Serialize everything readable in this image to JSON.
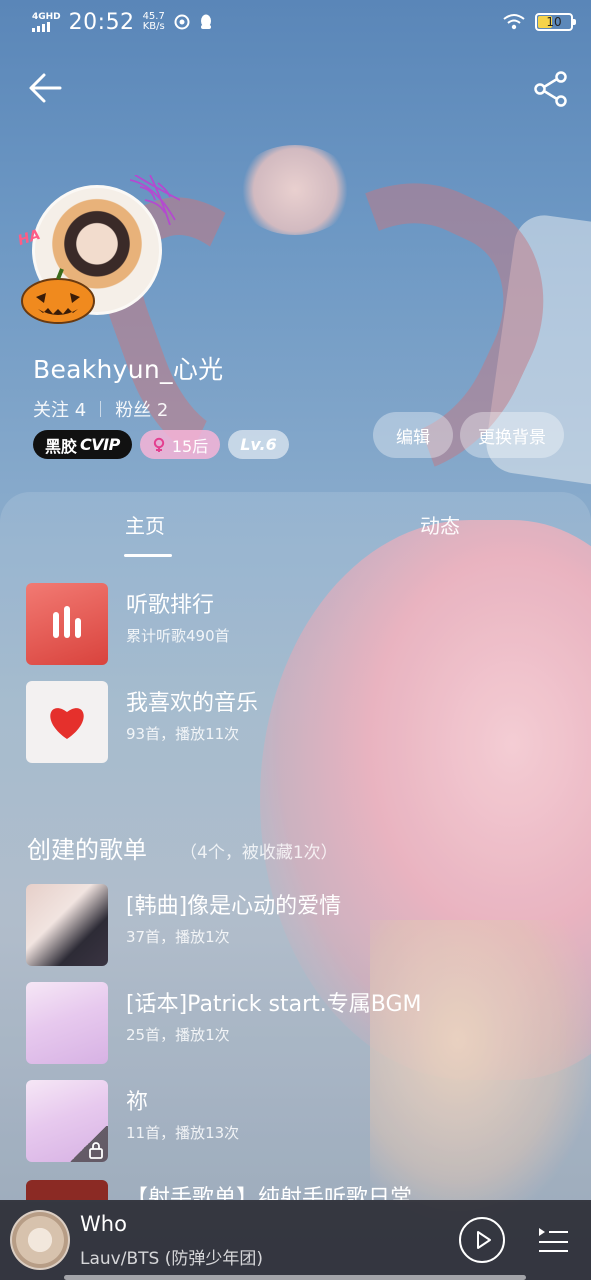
{
  "status_bar": {
    "network": "4GHD",
    "time": "20:52",
    "speed_value": "45.7",
    "speed_unit": "KB/s",
    "battery": "10",
    "icons": [
      "signal-icon",
      "sync-icon",
      "qq-icon",
      "wifi-icon",
      "battery-icon"
    ]
  },
  "header": {
    "back_icon": "arrow-left-icon",
    "share_icon": "share-icon"
  },
  "profile": {
    "username": "Beakhyun_心光",
    "following_label": "关注",
    "following_count": "4",
    "followers_label": "粉丝",
    "followers_count": "2",
    "badges": {
      "vip_prefix": "黑胶",
      "vip_label": "CVIP",
      "age_label": "15后",
      "level_label": "Lv.6"
    },
    "edit_label": "编辑",
    "change_bg_label": "更换背景"
  },
  "tabs": {
    "home": "主页",
    "feed": "动态"
  },
  "quick_items": [
    {
      "title": "听歌排行",
      "subtitle": "累计听歌490首",
      "icon": "bar-chart-icon"
    },
    {
      "title": "我喜欢的音乐",
      "subtitle": "93首，播放11次",
      "icon": "heart-icon"
    }
  ],
  "created_section": {
    "title": "创建的歌单",
    "meta": "（4个，被收藏1次）"
  },
  "playlists": [
    {
      "title": "[韩曲]像是心动的爱情",
      "subtitle": "37首，播放1次"
    },
    {
      "title": "[话本]Patrick start.专属BGM",
      "subtitle": "25首，播放1次"
    },
    {
      "title": "祢",
      "subtitle": "11首，播放13次",
      "locked": true
    }
  ],
  "partial_playlist_title": "【射手歌单】纯射手听歌日常",
  "player": {
    "song": "Who",
    "artist": "Lauv/BTS (防弹少年团)"
  },
  "colors": {
    "vip_badge_bg": "#111111",
    "age_badge_bg": "#f6b4d7",
    "rank_icon_bg": "#e4514a",
    "heart_red": "#e5302c"
  }
}
